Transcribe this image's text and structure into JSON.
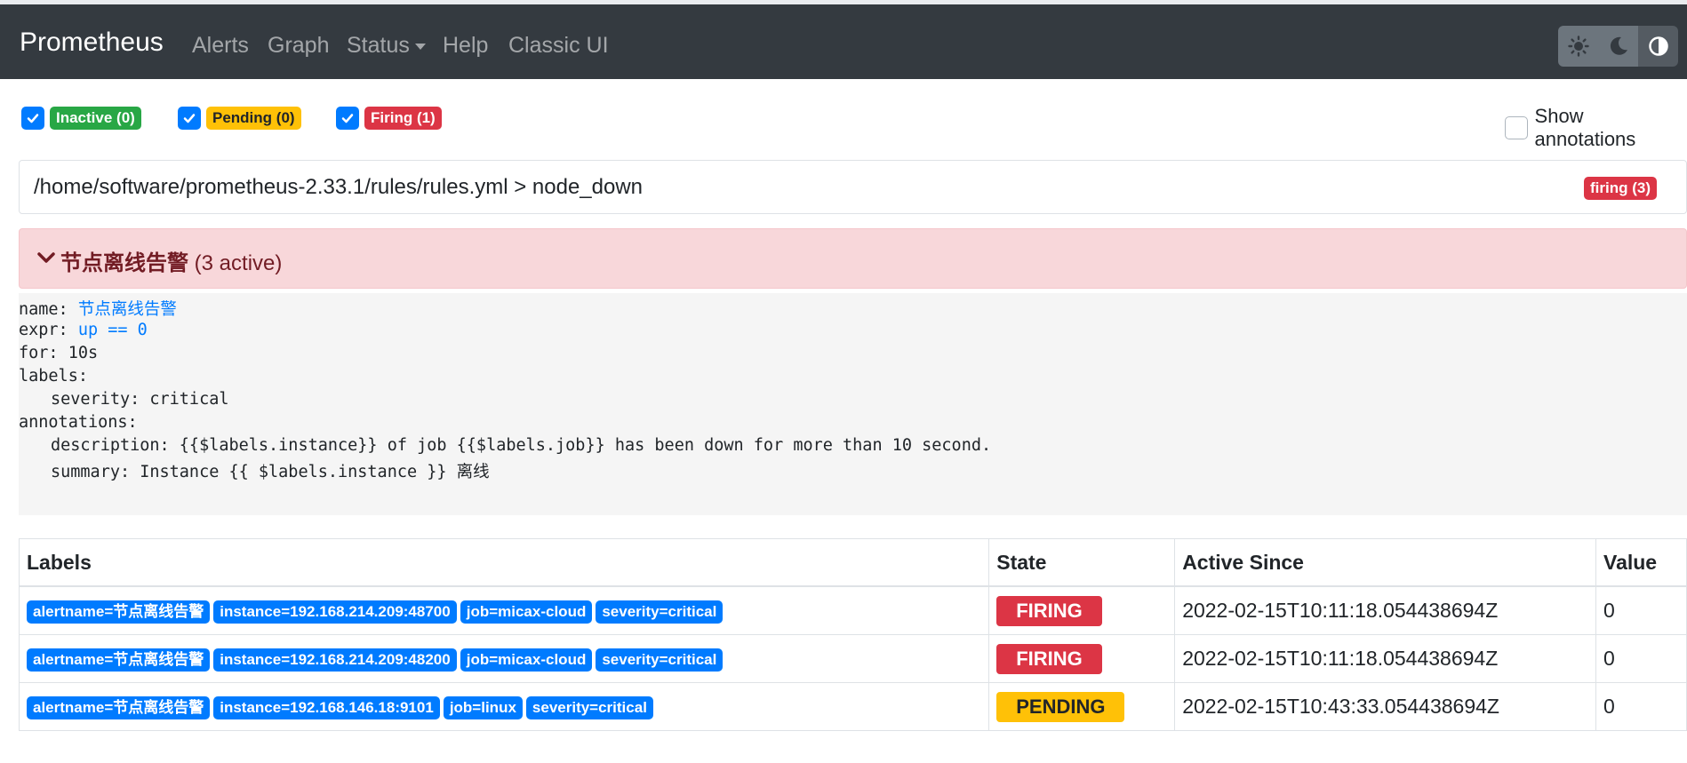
{
  "app": {
    "brand": "Prometheus"
  },
  "nav": {
    "alerts": "Alerts",
    "graph": "Graph",
    "status": "Status",
    "help": "Help",
    "classic": "Classic UI",
    "theme_icons": [
      "sun-icon",
      "moon-icon",
      "half-circle-icon"
    ]
  },
  "filters": {
    "inactive": "Inactive (0)",
    "pending": "Pending (0)",
    "firing": "Firing (1)",
    "show_annotations": "Show annotations"
  },
  "rule_group": {
    "path": "/home/software/prometheus-2.33.1/rules/rules.yml > node_down",
    "badge": "firing (3)"
  },
  "alert": {
    "title": "节点离线告警",
    "count": "(3 active)"
  },
  "definition": {
    "name_key": "name: ",
    "name_val": "节点离线告警",
    "expr_key": "expr: ",
    "expr_val": "up == 0",
    "for_line": "for: 10s",
    "labels_key": "labels:",
    "severity_line": "severity: critical",
    "annotations_key": "annotations:",
    "description_line": "description: {{$labels.instance}} of job {{$labels.job}} has been down for more than 10 second.",
    "summary_prefix": "summary: Instance {{ $labels.instance }} ",
    "summary_suffix": "离线"
  },
  "table": {
    "headers": {
      "labels": "Labels",
      "state": "State",
      "active_since": "Active Since",
      "value": "Value"
    },
    "rows": [
      {
        "labels": [
          "alertname=节点离线告警",
          "instance=192.168.214.209:48700",
          "job=micax-cloud",
          "severity=critical"
        ],
        "state": "FIRING",
        "active_since": "2022-02-15T10:11:18.054438694Z",
        "value": "0"
      },
      {
        "labels": [
          "alertname=节点离线告警",
          "instance=192.168.214.209:48200",
          "job=micax-cloud",
          "severity=critical"
        ],
        "state": "FIRING",
        "active_since": "2022-02-15T10:11:18.054438694Z",
        "value": "0"
      },
      {
        "labels": [
          "alertname=节点离线告警",
          "instance=192.168.146.18:9101",
          "job=linux",
          "severity=critical"
        ],
        "state": "PENDING",
        "active_since": "2022-02-15T10:43:33.054438694Z",
        "value": "0"
      }
    ]
  },
  "colors": {
    "navbar": "#343a40",
    "firing": "#dc3545",
    "pending": "#ffc107",
    "inactive": "#28a745",
    "label_badge": "#007bff"
  }
}
